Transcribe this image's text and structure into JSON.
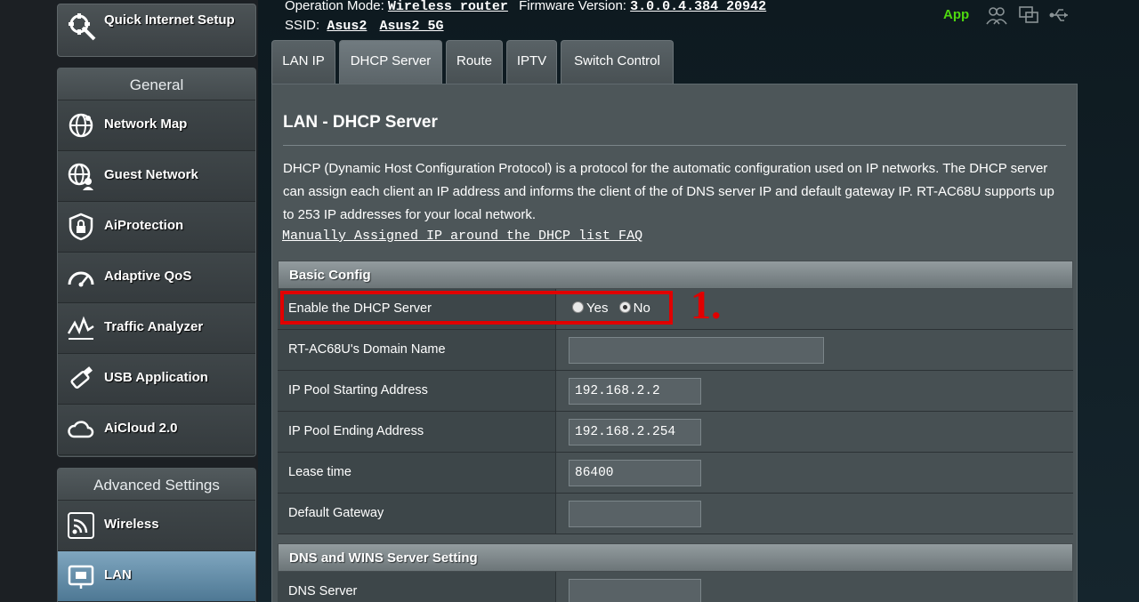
{
  "quick_setup": {
    "label": "Quick Internet Setup",
    "icon": "magic-wand-icon"
  },
  "sidebar": {
    "general": {
      "title": "General",
      "items": [
        {
          "label": "Network Map",
          "icon": "network-map-icon"
        },
        {
          "label": "Guest Network",
          "icon": "guest-network-icon"
        },
        {
          "label": "AiProtection",
          "icon": "shield-lock-icon"
        },
        {
          "label": "Adaptive QoS",
          "icon": "speedometer-icon"
        },
        {
          "label": "Traffic Analyzer",
          "icon": "traffic-analyzer-icon"
        },
        {
          "label": "USB Application",
          "icon": "usb-icon"
        },
        {
          "label": "AiCloud 2.0",
          "icon": "cloud-icon"
        }
      ]
    },
    "advanced": {
      "title": "Advanced Settings",
      "items": [
        {
          "label": "Wireless",
          "icon": "wireless-icon"
        },
        {
          "label": "LAN",
          "icon": "lan-icon",
          "active": true
        }
      ]
    }
  },
  "header": {
    "op_mode_label": "Operation Mode:",
    "op_mode_value": "Wireless router",
    "firmware_label": "Firmware Version:",
    "firmware_value": "3.0.0.4.384_20942",
    "ssid_label": "SSID:",
    "ssid_1": "Asus2",
    "ssid_2": "Asus2_5G",
    "app_label": "App",
    "app_color": "#4dd80f"
  },
  "tabs": [
    {
      "label": "LAN IP"
    },
    {
      "label": "DHCP Server",
      "active": true
    },
    {
      "label": "Route"
    },
    {
      "label": "IPTV"
    },
    {
      "label": "Switch Control"
    }
  ],
  "main": {
    "title": "LAN - DHCP Server",
    "description": "DHCP (Dynamic Host Configuration Protocol) is a protocol for the automatic configuration used on IP networks. The DHCP server can assign each client an IP address and informs the client of the of DNS server IP and default gateway IP. RT-AC68U supports up to 253 IP addresses for your local network.",
    "faq_link": "Manually Assigned IP around the DHCP list FAQ",
    "basic_config": {
      "title": "Basic Config",
      "enable_dhcp": {
        "label": "Enable the DHCP Server",
        "yes": "Yes",
        "no": "No",
        "selected": "No"
      },
      "domain_name": {
        "label": "RT-AC68U's Domain Name",
        "value": ""
      },
      "pool_start": {
        "label": "IP Pool Starting Address",
        "value": "192.168.2.2"
      },
      "pool_end": {
        "label": "IP Pool Ending Address",
        "value": "192.168.2.254"
      },
      "lease_time": {
        "label": "Lease time",
        "value": "86400"
      },
      "default_gateway": {
        "label": "Default Gateway",
        "value": ""
      }
    },
    "dns_section": {
      "title": "DNS and WINS Server Setting",
      "dns_server": {
        "label": "DNS Server",
        "value": ""
      }
    }
  },
  "annotation": {
    "text": "1.",
    "color": "#e10000"
  }
}
